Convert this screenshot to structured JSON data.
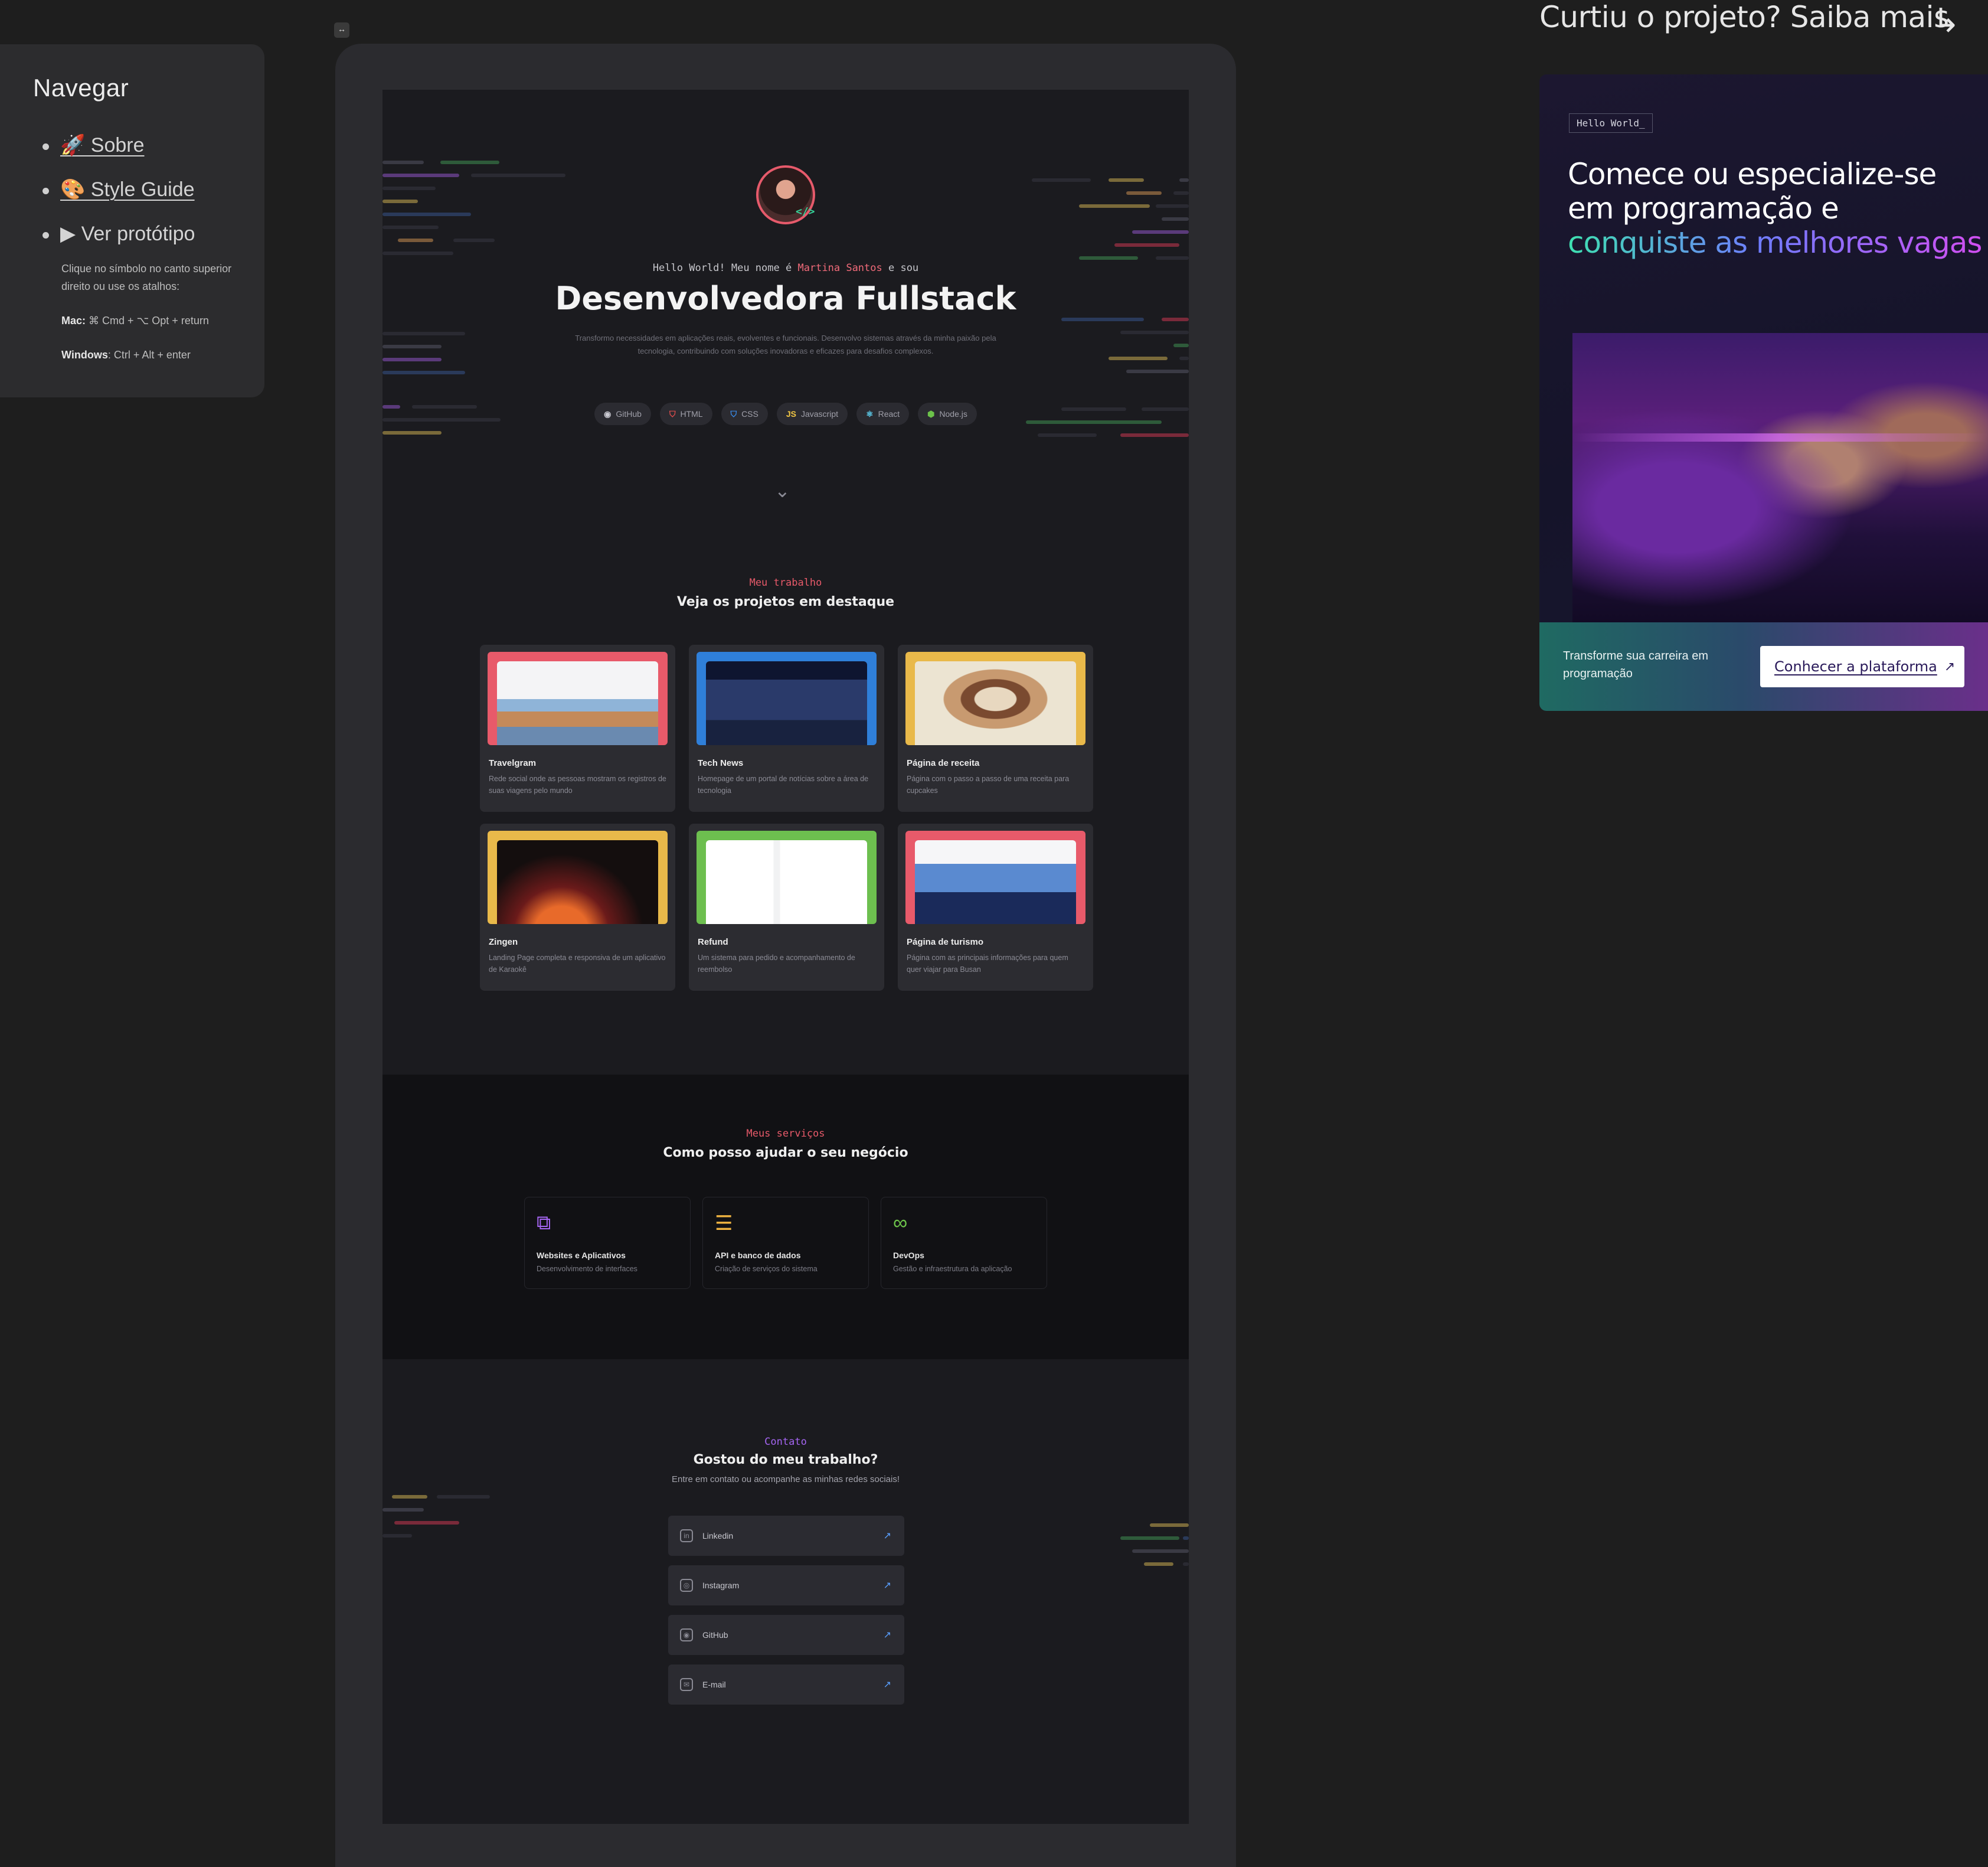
{
  "nav": {
    "title": "Navegar",
    "items": [
      {
        "label": "🚀 Sobre"
      },
      {
        "label": "🎨 Style Guide"
      },
      {
        "label": "▶ Ver protótipo"
      }
    ],
    "help_text": "Clique no símbolo no canto superior direito ou use os atalhos:",
    "mac_label": "Mac:",
    "mac_keys": "⌘ Cmd + ⌥ Opt + return",
    "windows_label": "Windows",
    "windows_keys": ": Ctrl + Alt + enter"
  },
  "tiny_button": "↔",
  "hero": {
    "hello_prefix": "Hello World! Meu nome é ",
    "name": "Martina Santos",
    "hello_suffix": " e sou",
    "role": "Desenvolvedora Fullstack",
    "bio": "Transformo necessidades em aplicações reais, evolventes e funcionais. Desenvolvo sistemas através da minha paixão pela tecnologia, contribuindo com soluções inovadoras e eficazes para desafios complexos.",
    "avatar_code": "</>",
    "tags": [
      {
        "icon": "github-icon",
        "glyph": "◉",
        "label": "GitHub",
        "color": "#c9c9d1"
      },
      {
        "icon": "html-icon",
        "glyph": "⛉",
        "label": "HTML",
        "color": "#e44d4d"
      },
      {
        "icon": "css-icon",
        "glyph": "⛉",
        "label": "CSS",
        "color": "#3a8eef"
      },
      {
        "icon": "javascript-icon",
        "glyph": "JS",
        "label": "Javascript",
        "color": "#f2c744"
      },
      {
        "icon": "react-icon",
        "glyph": "⚛",
        "label": "React",
        "color": "#5ed3f3"
      },
      {
        "icon": "nodejs-icon",
        "glyph": "⬢",
        "label": "Node.js",
        "color": "#6cc24a"
      }
    ],
    "scroll_glyph": "⌄"
  },
  "work": {
    "kicker": "Meu trabalho",
    "title": "Veja os projetos em destaque",
    "projects": [
      {
        "title": "Travelgram",
        "desc": "Rede social onde as pessoas mostram os registros de suas viagens pelo mundo",
        "color": "#e85a6a",
        "inner": "#f4f4f6"
      },
      {
        "title": "Tech News",
        "desc": "Homepage de um portal de notícias sobre a área de tecnologia",
        "color": "#2f7fd9",
        "inner": "#111a33"
      },
      {
        "title": "Página de receita",
        "desc": "Página com o passo a passo de uma receita para cupcakes",
        "color": "#e9b94a",
        "inner": "#ece4d2"
      },
      {
        "title": "Zingen",
        "desc": "Landing Page completa e responsiva de um aplicativo de Karaokê",
        "color": "#e9b94a",
        "inner": "#1a1212"
      },
      {
        "title": "Refund",
        "desc": "Um sistema para pedido e acompanhamento de reembolso",
        "color": "#6dbf4f",
        "inner": "#f1f2f3"
      },
      {
        "title": "Página de turismo",
        "desc": "Página com as principais informações para quem quer viajar para Busan",
        "color": "#e85a6a",
        "inner": "#f6f6f8"
      }
    ]
  },
  "services": {
    "kicker": "Meus serviços",
    "title": "Como posso ajudar o seu negócio",
    "items": [
      {
        "icon": "devices-icon",
        "glyph": "⧉",
        "color": "#a565f2",
        "title": "Websites e Aplicativos",
        "desc": "Desenvolvimento de interfaces"
      },
      {
        "icon": "server-icon",
        "glyph": "☰",
        "color": "#f0b441",
        "title": "API e banco de dados",
        "desc": "Criação de serviços do sistema"
      },
      {
        "icon": "infinity-icon",
        "glyph": "∞",
        "color": "#6cc24a",
        "title": "DevOps",
        "desc": "Gestão e infraestrutura da aplicação"
      }
    ]
  },
  "contact": {
    "kicker": "Contato",
    "title": "Gostou do meu trabalho?",
    "subtitle": "Entre em contato ou acompanhe as minhas redes sociais!",
    "links": [
      {
        "icon": "linkedin-icon",
        "glyph": "in",
        "label": "Linkedin"
      },
      {
        "icon": "instagram-icon",
        "glyph": "◎",
        "label": "Instagram"
      },
      {
        "icon": "github-icon",
        "glyph": "◉",
        "label": "GitHub"
      },
      {
        "icon": "email-icon",
        "glyph": "✉",
        "label": "E-mail"
      }
    ],
    "arrow": "↗"
  },
  "promo": {
    "title": "Curtiu o projeto? Saiba mais",
    "arrow": "↳",
    "badge": "Hello World_",
    "head_line1": "Comece ou especialize-se",
    "head_line2": "em programação e",
    "head_highlight": "conquiste as melhores vagas",
    "bar_text": "Transforme sua carreira em programação",
    "button_label": "Conhecer a plataforma",
    "button_arrow": "↗"
  }
}
